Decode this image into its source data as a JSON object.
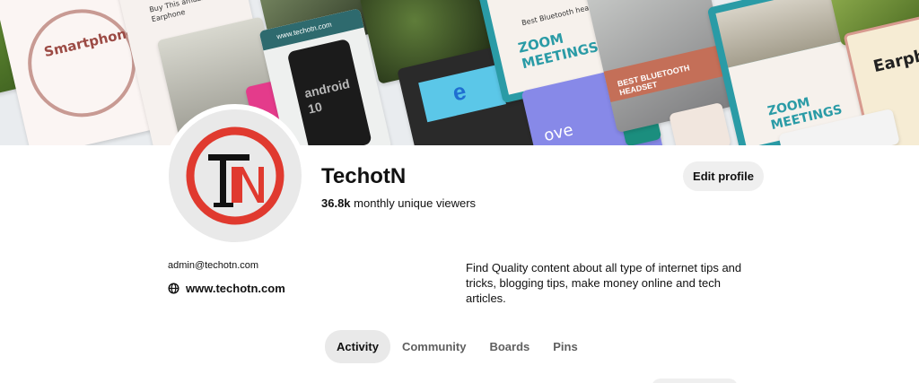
{
  "cover": {
    "tiles": {
      "smartphones": "Smartphones",
      "earphone": "Buy This amazing Earphone",
      "site": "www.techotn.com",
      "android": "android 10",
      "zoom_small": "Best Bluetooth headset for",
      "zoom_meetings": "ZOOM MEETINGS",
      "headset": "BEST BLUETOOTH HEADSET",
      "love": "ove",
      "earph": "Earph"
    }
  },
  "profile": {
    "name": "TechotN",
    "viewers_count": "36.8k",
    "viewers_label": "monthly unique viewers",
    "email": "admin@techotn.com",
    "website": "www.techotn.com",
    "about": "Find Quality content about all type of internet tips and tricks, blogging tips, make money online and tech articles.",
    "avatar_letters": "TN"
  },
  "actions": {
    "edit_profile": "Edit profile"
  },
  "tabs": [
    {
      "label": "Activity",
      "active": true
    },
    {
      "label": "Community",
      "active": false
    },
    {
      "label": "Boards",
      "active": false
    },
    {
      "label": "Pins",
      "active": false
    }
  ],
  "colors": {
    "brand_red": "#e03a2f",
    "avatar_black": "#111111"
  },
  "icons": {
    "website": "globe-icon"
  }
}
